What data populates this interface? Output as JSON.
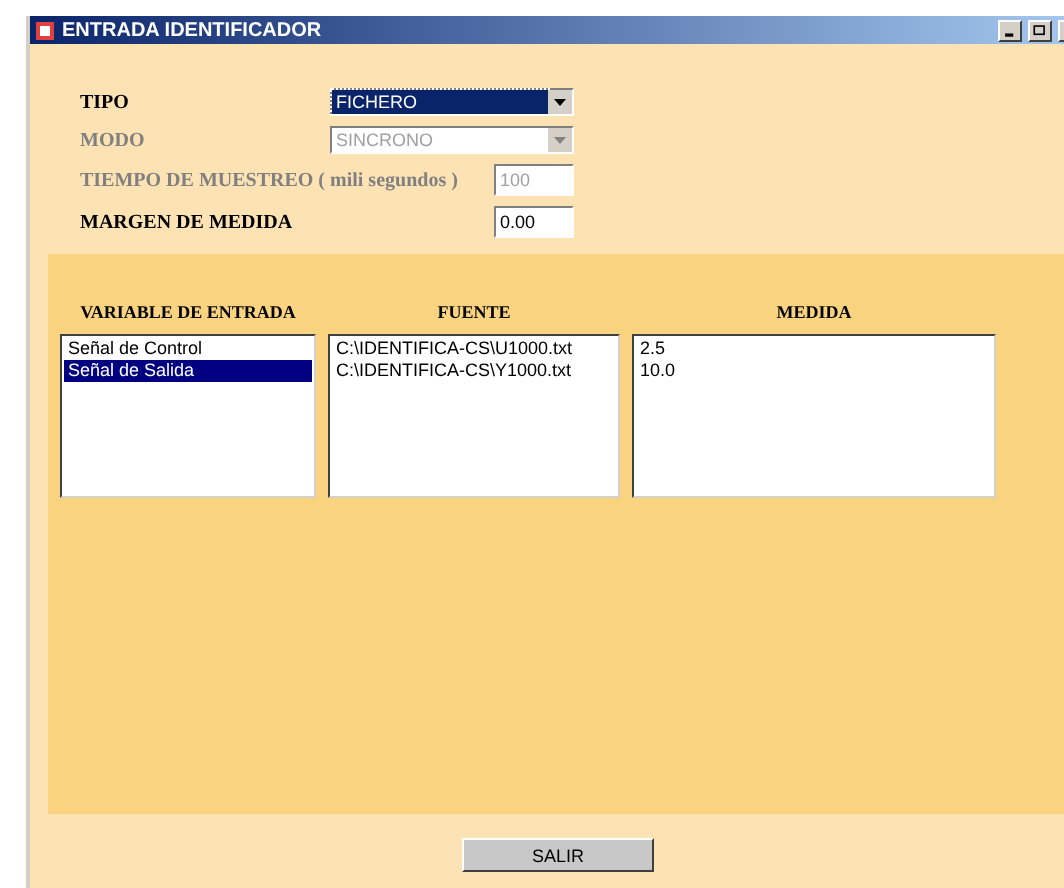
{
  "window": {
    "title": "ENTRADA IDENTIFICADOR"
  },
  "fields": [
    {
      "kind": "combo",
      "label": "TIPO",
      "value": "FICHERO",
      "disabled": false,
      "focused": true
    },
    {
      "kind": "combo",
      "label": "MODO",
      "value": "SINCRONO",
      "disabled": true,
      "focused": false
    },
    {
      "kind": "text",
      "label": "TIEMPO DE MUESTREO ( mili segundos )",
      "value": "100",
      "disabled": true
    },
    {
      "kind": "text",
      "label": "MARGEN DE MEDIDA",
      "value": "0.00",
      "disabled": false
    }
  ],
  "lists": [
    {
      "header": "VARIABLE DE ENTRADA",
      "items": [
        {
          "text": "Señal de Control",
          "selected": false
        },
        {
          "text": "Señal de Salida",
          "selected": true
        }
      ]
    },
    {
      "header": "FUENTE",
      "items": [
        {
          "text": "C:\\IDENTIFICA-CS\\U1000.txt",
          "selected": false
        },
        {
          "text": "C:\\IDENTIFICA-CS\\Y1000.txt",
          "selected": false
        }
      ]
    },
    {
      "header": "MEDIDA",
      "items": [
        {
          "text": "2.5",
          "selected": false
        },
        {
          "text": "10.0",
          "selected": false
        }
      ]
    }
  ],
  "buttons": [
    "SALIR"
  ]
}
